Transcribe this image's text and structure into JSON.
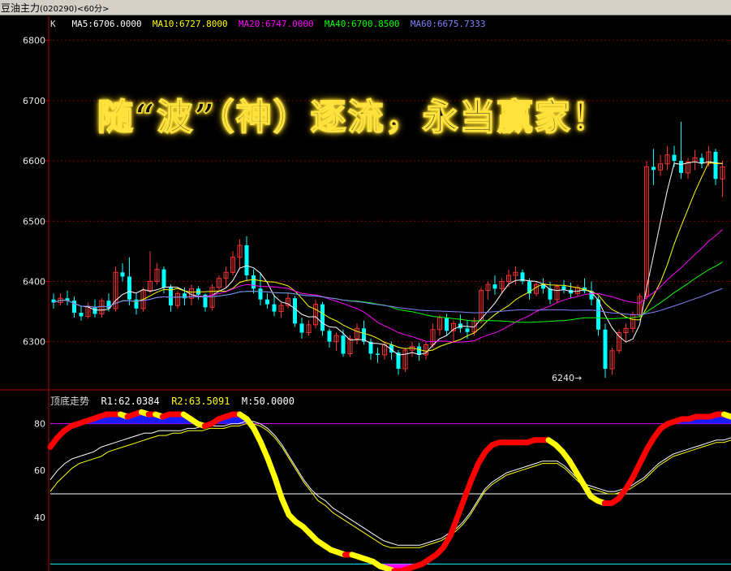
{
  "window": {
    "title_main": "豆油主力",
    "title_code": "(020290)",
    "title_period": "<60分>"
  },
  "slogan": "随“波”（神）逐流，永当赢家！",
  "colors": {
    "ma5": "#ffffff",
    "ma10": "#ffff00",
    "ma20": "#ff00ff",
    "ma40": "#00ff00",
    "ma60": "#8080ff",
    "up": "#ff3030",
    "down": "#00ffff",
    "grid": "#8b0000",
    "frame": "#b00000",
    "r1_rising": "#ff0000",
    "r1_falling": "#ffff00",
    "fill_top": "#1a1aff",
    "fill_bottom": "#ff00ff"
  },
  "chart_data": [
    {
      "type": "candlestick",
      "title": "K",
      "legend": [
        {
          "name": "MA5",
          "value": "6706.0000"
        },
        {
          "name": "MA10",
          "value": "6727.8000"
        },
        {
          "name": "MA20",
          "value": "6747.0000"
        },
        {
          "name": "MA40",
          "value": "6700.8500"
        },
        {
          "name": "MA60",
          "value": "6675.7333"
        }
      ],
      "y_ticks": [
        6300,
        6400,
        6500,
        6600,
        6700,
        6800
      ],
      "ylim": [
        6220,
        6840
      ],
      "grid": true,
      "annotation": "6240→",
      "annotation_value": 6240,
      "candles_ohlc": [
        [
          6370,
          6380,
          6355,
          6365
        ],
        [
          6365,
          6380,
          6360,
          6372
        ],
        [
          6372,
          6385,
          6360,
          6368
        ],
        [
          6368,
          6375,
          6340,
          6348
        ],
        [
          6348,
          6360,
          6335,
          6342
        ],
        [
          6342,
          6365,
          6338,
          6358
        ],
        [
          6358,
          6370,
          6340,
          6346
        ],
        [
          6346,
          6372,
          6340,
          6368
        ],
        [
          6368,
          6380,
          6350,
          6355
        ],
        [
          6355,
          6425,
          6350,
          6415
        ],
        [
          6415,
          6430,
          6400,
          6408
        ],
        [
          6408,
          6440,
          6360,
          6370
        ],
        [
          6370,
          6380,
          6345,
          6355
        ],
        [
          6355,
          6390,
          6350,
          6385
        ],
        [
          6385,
          6450,
          6380,
          6400
        ],
        [
          6400,
          6430,
          6395,
          6420
        ],
        [
          6420,
          6425,
          6380,
          6390
        ],
        [
          6390,
          6395,
          6350,
          6360
        ],
        [
          6360,
          6385,
          6355,
          6380
        ],
        [
          6380,
          6390,
          6360,
          6372
        ],
        [
          6372,
          6395,
          6360,
          6388
        ],
        [
          6388,
          6392,
          6370,
          6378
        ],
        [
          6378,
          6380,
          6350,
          6357
        ],
        [
          6357,
          6395,
          6352,
          6390
        ],
        [
          6390,
          6410,
          6385,
          6405
        ],
        [
          6405,
          6425,
          6390,
          6415
        ],
        [
          6415,
          6450,
          6410,
          6440
        ],
        [
          6440,
          6470,
          6420,
          6460
        ],
        [
          6460,
          6475,
          6400,
          6410
        ],
        [
          6410,
          6420,
          6380,
          6388
        ],
        [
          6388,
          6415,
          6360,
          6370
        ],
        [
          6370,
          6380,
          6355,
          6362
        ],
        [
          6362,
          6378,
          6342,
          6350
        ],
        [
          6350,
          6365,
          6340,
          6360
        ],
        [
          6360,
          6380,
          6355,
          6372
        ],
        [
          6372,
          6376,
          6325,
          6330
        ],
        [
          6330,
          6340,
          6305,
          6315
        ],
        [
          6315,
          6335,
          6310,
          6328
        ],
        [
          6328,
          6370,
          6322,
          6362
        ],
        [
          6362,
          6366,
          6310,
          6318
        ],
        [
          6318,
          6322,
          6290,
          6300
        ],
        [
          6300,
          6315,
          6285,
          6310
        ],
        [
          6310,
          6320,
          6275,
          6280
        ],
        [
          6280,
          6310,
          6275,
          6305
        ],
        [
          6305,
          6330,
          6295,
          6322
        ],
        [
          6322,
          6335,
          6295,
          6300
        ],
        [
          6300,
          6305,
          6270,
          6280
        ],
        [
          6280,
          6290,
          6265,
          6278
        ],
        [
          6278,
          6300,
          6270,
          6295
        ],
        [
          6295,
          6300,
          6270,
          6282
        ],
        [
          6282,
          6286,
          6245,
          6255
        ],
        [
          6255,
          6290,
          6250,
          6286
        ],
        [
          6286,
          6300,
          6275,
          6292
        ],
        [
          6292,
          6298,
          6268,
          6278
        ],
        [
          6278,
          6300,
          6270,
          6295
        ],
        [
          6295,
          6330,
          6290,
          6320
        ],
        [
          6320,
          6345,
          6310,
          6340
        ],
        [
          6340,
          6346,
          6310,
          6318
        ],
        [
          6318,
          6335,
          6300,
          6330
        ],
        [
          6330,
          6345,
          6315,
          6322
        ],
        [
          6322,
          6335,
          6305,
          6316
        ],
        [
          6316,
          6340,
          6310,
          6335
        ],
        [
          6335,
          6390,
          6330,
          6385
        ],
        [
          6385,
          6400,
          6370,
          6395
        ],
        [
          6395,
          6410,
          6378,
          6388
        ],
        [
          6388,
          6405,
          6380,
          6400
        ],
        [
          6400,
          6420,
          6390,
          6410
        ],
        [
          6410,
          6425,
          6395,
          6415
        ],
        [
          6415,
          6420,
          6395,
          6400
        ],
        [
          6400,
          6405,
          6370,
          6380
        ],
        [
          6380,
          6400,
          6375,
          6395
        ],
        [
          6395,
          6405,
          6380,
          6388
        ],
        [
          6388,
          6400,
          6362,
          6370
        ],
        [
          6370,
          6395,
          6365,
          6392
        ],
        [
          6392,
          6402,
          6380,
          6386
        ],
        [
          6386,
          6398,
          6372,
          6380
        ],
        [
          6380,
          6395,
          6375,
          6390
        ],
        [
          6390,
          6405,
          6380,
          6384
        ],
        [
          6384,
          6400,
          6360,
          6370
        ],
        [
          6370,
          6375,
          6310,
          6320
        ],
        [
          6320,
          6330,
          6240,
          6255
        ],
        [
          6255,
          6290,
          6245,
          6285
        ],
        [
          6285,
          6320,
          6280,
          6315
        ],
        [
          6315,
          6330,
          6300,
          6322
        ],
        [
          6322,
          6350,
          6315,
          6345
        ],
        [
          6345,
          6380,
          6340,
          6375
        ],
        [
          6375,
          6600,
          6370,
          6590
        ],
        [
          6590,
          6620,
          6560,
          6585
        ],
        [
          6585,
          6610,
          6575,
          6595
        ],
        [
          6595,
          6625,
          6585,
          6610
        ],
        [
          6610,
          6625,
          6590,
          6600
        ],
        [
          6600,
          6665,
          6570,
          6580
        ],
        [
          6580,
          6605,
          6570,
          6598
        ],
        [
          6598,
          6618,
          6585,
          6605
        ],
        [
          6605,
          6612,
          6588,
          6596
        ],
        [
          6596,
          6625,
          6590,
          6615
        ],
        [
          6615,
          6620,
          6560,
          6570
        ],
        [
          6570,
          6600,
          6540,
          6590
        ]
      ]
    },
    {
      "type": "line",
      "title": "顶底走势",
      "legend": [
        {
          "name": "R1",
          "value": "62.0384"
        },
        {
          "name": "R2",
          "value": "63.5091"
        },
        {
          "name": "M",
          "value": "50.0000"
        }
      ],
      "y_ticks": [
        40,
        60,
        80
      ],
      "ylim": [
        17,
        91
      ],
      "reference_lines": [
        80,
        50,
        20
      ],
      "series": [
        {
          "name": "R1",
          "values": [
            70,
            74,
            77,
            79,
            80,
            81,
            82,
            83,
            84,
            84,
            84,
            83,
            84,
            85,
            84,
            84,
            83,
            84,
            84,
            84,
            82,
            80,
            79,
            80,
            82,
            83,
            84,
            84,
            82,
            78,
            72,
            65,
            57,
            48,
            41,
            38,
            36,
            33,
            30,
            28,
            26,
            25,
            24,
            24,
            23,
            22,
            21,
            19,
            18,
            17,
            17,
            18,
            19,
            20,
            22,
            24,
            27,
            32,
            40,
            48,
            56,
            63,
            68,
            71,
            72,
            72,
            72,
            72,
            72,
            73,
            73,
            73,
            71,
            68,
            64,
            59,
            54,
            49,
            47,
            46,
            46,
            48,
            52,
            57,
            63,
            69,
            74,
            78,
            80,
            81,
            82,
            82,
            83,
            83,
            83,
            84,
            84,
            83
          ]
        },
        {
          "name": "R2",
          "values": [
            56,
            60,
            63,
            65,
            66,
            67,
            68,
            70,
            71,
            72,
            73,
            74,
            75,
            76,
            76,
            77,
            77,
            77,
            77,
            78,
            78,
            79,
            79,
            79,
            79,
            80,
            80,
            81,
            81,
            80,
            78,
            75,
            71,
            66,
            61,
            56,
            52,
            49,
            47,
            44,
            42,
            40,
            38,
            36,
            34,
            32,
            30,
            29,
            28,
            28,
            28,
            28,
            29,
            30,
            31,
            33,
            35,
            38,
            42,
            47,
            52,
            55,
            57,
            59,
            60,
            61,
            62,
            63,
            64,
            64,
            64,
            62,
            59,
            56,
            54,
            53,
            52,
            51,
            51,
            52,
            53,
            55,
            57,
            60,
            63,
            65,
            67,
            68,
            69,
            70,
            71,
            72,
            73,
            73,
            74
          ]
        },
        {
          "name": "R2b",
          "values": [
            51,
            55,
            58,
            61,
            63,
            64,
            65,
            66,
            68,
            69,
            70,
            71,
            72,
            73,
            74,
            75,
            75,
            76,
            76,
            77,
            77,
            77,
            78,
            78,
            78,
            79,
            79,
            80,
            80,
            79,
            77,
            74,
            70,
            65,
            60,
            55,
            51,
            47,
            45,
            42,
            40,
            38,
            36,
            34,
            32,
            30,
            28,
            27,
            27,
            27,
            27,
            27,
            28,
            29,
            30,
            32,
            34,
            37,
            41,
            46,
            51,
            54,
            56,
            58,
            59,
            60,
            61,
            62,
            63,
            63,
            63,
            61,
            58,
            55,
            53,
            52,
            51,
            50,
            50,
            51,
            52,
            54,
            56,
            59,
            62,
            64,
            66,
            67,
            68,
            69,
            70,
            71,
            72,
            72,
            73
          ]
        }
      ]
    }
  ]
}
